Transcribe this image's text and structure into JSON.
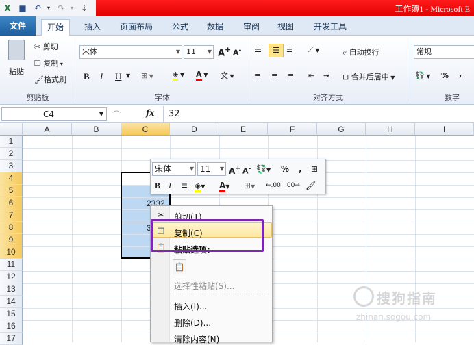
{
  "window": {
    "title": "工作簿1 - Microsoft E"
  },
  "quick_access": [
    "excel-logo-icon",
    "save-icon",
    "undo-icon",
    "redo-icon"
  ],
  "tabs": [
    {
      "label": "文件"
    },
    {
      "label": "开始"
    },
    {
      "label": "插入"
    },
    {
      "label": "页面布局"
    },
    {
      "label": "公式"
    },
    {
      "label": "数据"
    },
    {
      "label": "审阅"
    },
    {
      "label": "视图"
    },
    {
      "label": "开发工具"
    }
  ],
  "ribbon": {
    "clipboard": {
      "paste": "粘贴",
      "cut": "剪切",
      "copy": "复制",
      "format_painter": "格式刷",
      "group": "剪贴板"
    },
    "font": {
      "name": "宋体",
      "size": "11",
      "group": "字体",
      "bold": "B",
      "italic": "I",
      "underline": "U",
      "grow": "A",
      "shrink": "A",
      "font_color": "A",
      "phonetic": "文"
    },
    "alignment": {
      "wrap": "自动换行",
      "merge": "合并后居中",
      "group": "对齐方式"
    },
    "number": {
      "format": "常规",
      "percent": "%",
      "comma": ",",
      "group": "数字"
    }
  },
  "formula_bar": {
    "name_box": "C4",
    "fx": "fx",
    "value": "32"
  },
  "columns": [
    "A",
    "B",
    "C",
    "D",
    "E",
    "F",
    "G",
    "H",
    "I"
  ],
  "rows": [
    "1",
    "2",
    "3",
    "4",
    "5",
    "6",
    "7",
    "8",
    "9",
    "10",
    "11",
    "12",
    "13",
    "14",
    "15",
    "16",
    "17"
  ],
  "cells": {
    "C6": "2332",
    "C8": "3"
  },
  "mini_toolbar": {
    "font": "宋体",
    "size": "11",
    "percent": "%",
    "comma": ",",
    "bold": "B",
    "italic": "I",
    "font_color": "A",
    "inc_decimal": ".00",
    "dec_decimal": ".00"
  },
  "context_menu": {
    "cut": "剪切(T)",
    "copy": "复制(C)",
    "paste_options": "粘贴选项:",
    "paste_special": "选择性粘贴(S)...",
    "insert": "插入(I)...",
    "delete": "删除(D)...",
    "clear": "清除内容(N)"
  },
  "watermark": {
    "title": "搜狗指南",
    "url": "zhinan.sogou.com"
  },
  "colors": {
    "title_bar": "#e00000",
    "file_tab": "#2a6fb3",
    "selection": "#bcd8f2",
    "annotation": "#7d27b0",
    "menu_highlight": "#fde7a1"
  }
}
